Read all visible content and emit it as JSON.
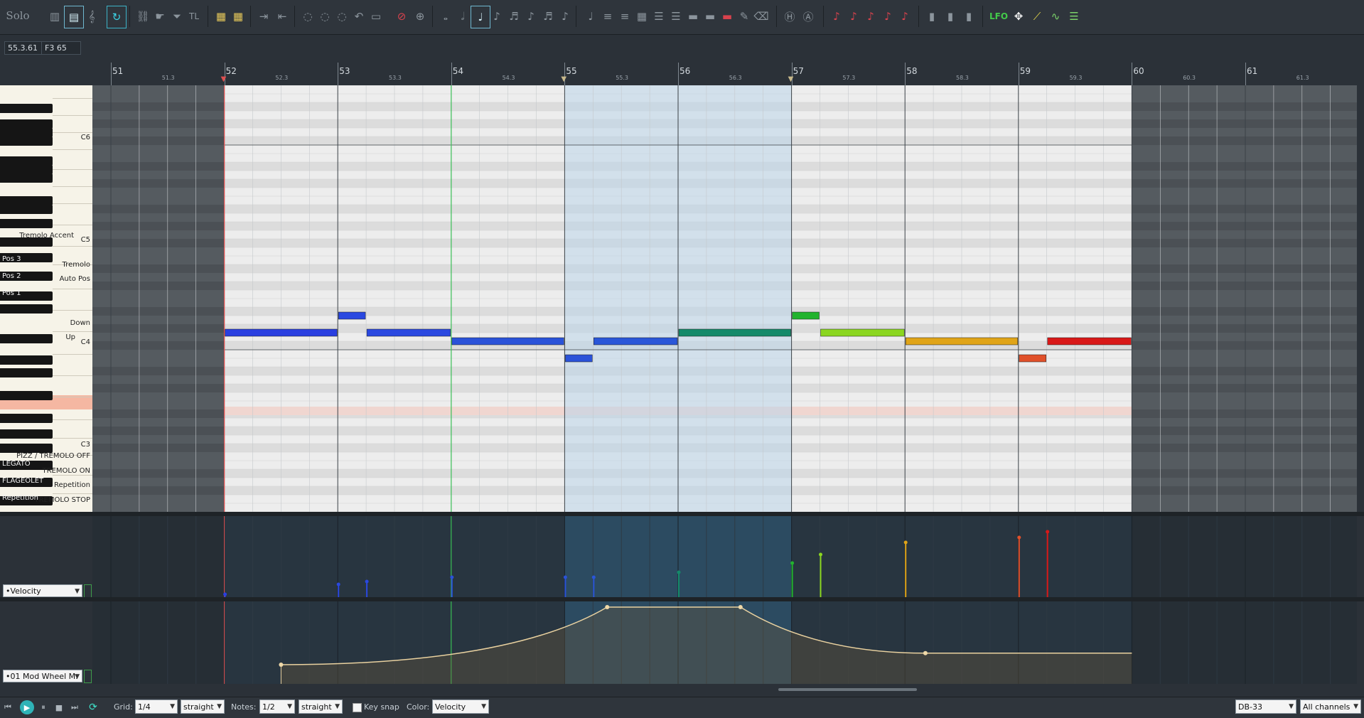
{
  "toolbar": {
    "solo_label": "Solo",
    "lfo_label": "LFO",
    "tl_label": "TL"
  },
  "readouts": {
    "position": "55.3.61",
    "pitch": "F3  65"
  },
  "ruler": {
    "bars": [
      "51",
      "52",
      "53",
      "54",
      "55",
      "56",
      "57",
      "58",
      "59",
      "60",
      "61"
    ],
    "subs": [
      "51.3",
      "52.3",
      "53.3",
      "54.3",
      "55.3",
      "56.3",
      "57.3",
      "58.3",
      "59.3",
      "60.3",
      "61.3"
    ]
  },
  "keyboard": {
    "octave_labels": [
      "C6",
      "C5",
      "C4",
      "C3"
    ],
    "keyswitch_labels_white": [
      "Tremolo Accent",
      "Tremolo",
      "Auto Pos",
      "Down",
      "Up",
      "PIZZ / TREMOLO OFF",
      "TREMOLO ON",
      "Repetition",
      "TREMOLO STOP"
    ],
    "keyswitch_labels_black": [
      "Pos 3",
      "Pos 2",
      "Pos 1",
      "LEGATO",
      "FLAGEOLET",
      "Repetition"
    ]
  },
  "notes": [
    {
      "start": 52.0,
      "end": 53.0,
      "row": 29,
      "color": "#2a3fe0",
      "velocity": 4
    },
    {
      "start": 53.0,
      "end": 53.25,
      "row": 27,
      "color": "#2a48e0",
      "velocity": 18
    },
    {
      "start": 53.25,
      "end": 54.0,
      "row": 29,
      "color": "#2a48e0",
      "velocity": 22
    },
    {
      "start": 54.0,
      "end": 55.0,
      "row": 30,
      "color": "#2a52d8",
      "velocity": 28
    },
    {
      "start": 55.0,
      "end": 55.25,
      "row": 32,
      "color": "#2a52d8",
      "velocity": 28
    },
    {
      "start": 55.25,
      "end": 56.0,
      "row": 30,
      "color": "#2a56d8",
      "velocity": 28
    },
    {
      "start": 56.0,
      "end": 57.0,
      "row": 29,
      "color": "#148a6a",
      "velocity": 35
    },
    {
      "start": 57.0,
      "end": 57.25,
      "row": 27,
      "color": "#22b32e",
      "velocity": 48
    },
    {
      "start": 57.25,
      "end": 58.0,
      "row": 29,
      "color": "#8bd620",
      "velocity": 60
    },
    {
      "start": 58.0,
      "end": 59.0,
      "row": 30,
      "color": "#e0a418",
      "velocity": 77
    },
    {
      "start": 59.0,
      "end": 59.25,
      "row": 32,
      "color": "#e0502a",
      "velocity": 84
    },
    {
      "start": 59.25,
      "end": 60.0,
      "row": 30,
      "color": "#d81818",
      "velocity": 92
    }
  ],
  "cc_curve": [
    {
      "bar": 52.5,
      "value": 20
    },
    {
      "bar": 55.375,
      "value": 80
    },
    {
      "bar": 56.55,
      "value": 80
    },
    {
      "bar": 58.18,
      "value": 32
    },
    {
      "bar": 60.0,
      "value": 32
    }
  ],
  "lanes": {
    "velocity_label": "•Velocity",
    "cc_label": "•01 Mod Wheel M:"
  },
  "bottombar": {
    "grid_label": "Grid:",
    "grid_value": "1/4",
    "grid_type": "straight",
    "notes_label": "Notes:",
    "notes_value": "1/2",
    "notes_type": "straight",
    "keysnap_label": "Key snap",
    "color_label": "Color:",
    "color_value": "Velocity",
    "synth_value": "DB-33",
    "channels_value": "All channels"
  },
  "colors": {
    "selection": "#bcd6ea",
    "playhead": "#e05050",
    "edit_cursor": "#40e060",
    "cc_line": "#ead2a0"
  }
}
